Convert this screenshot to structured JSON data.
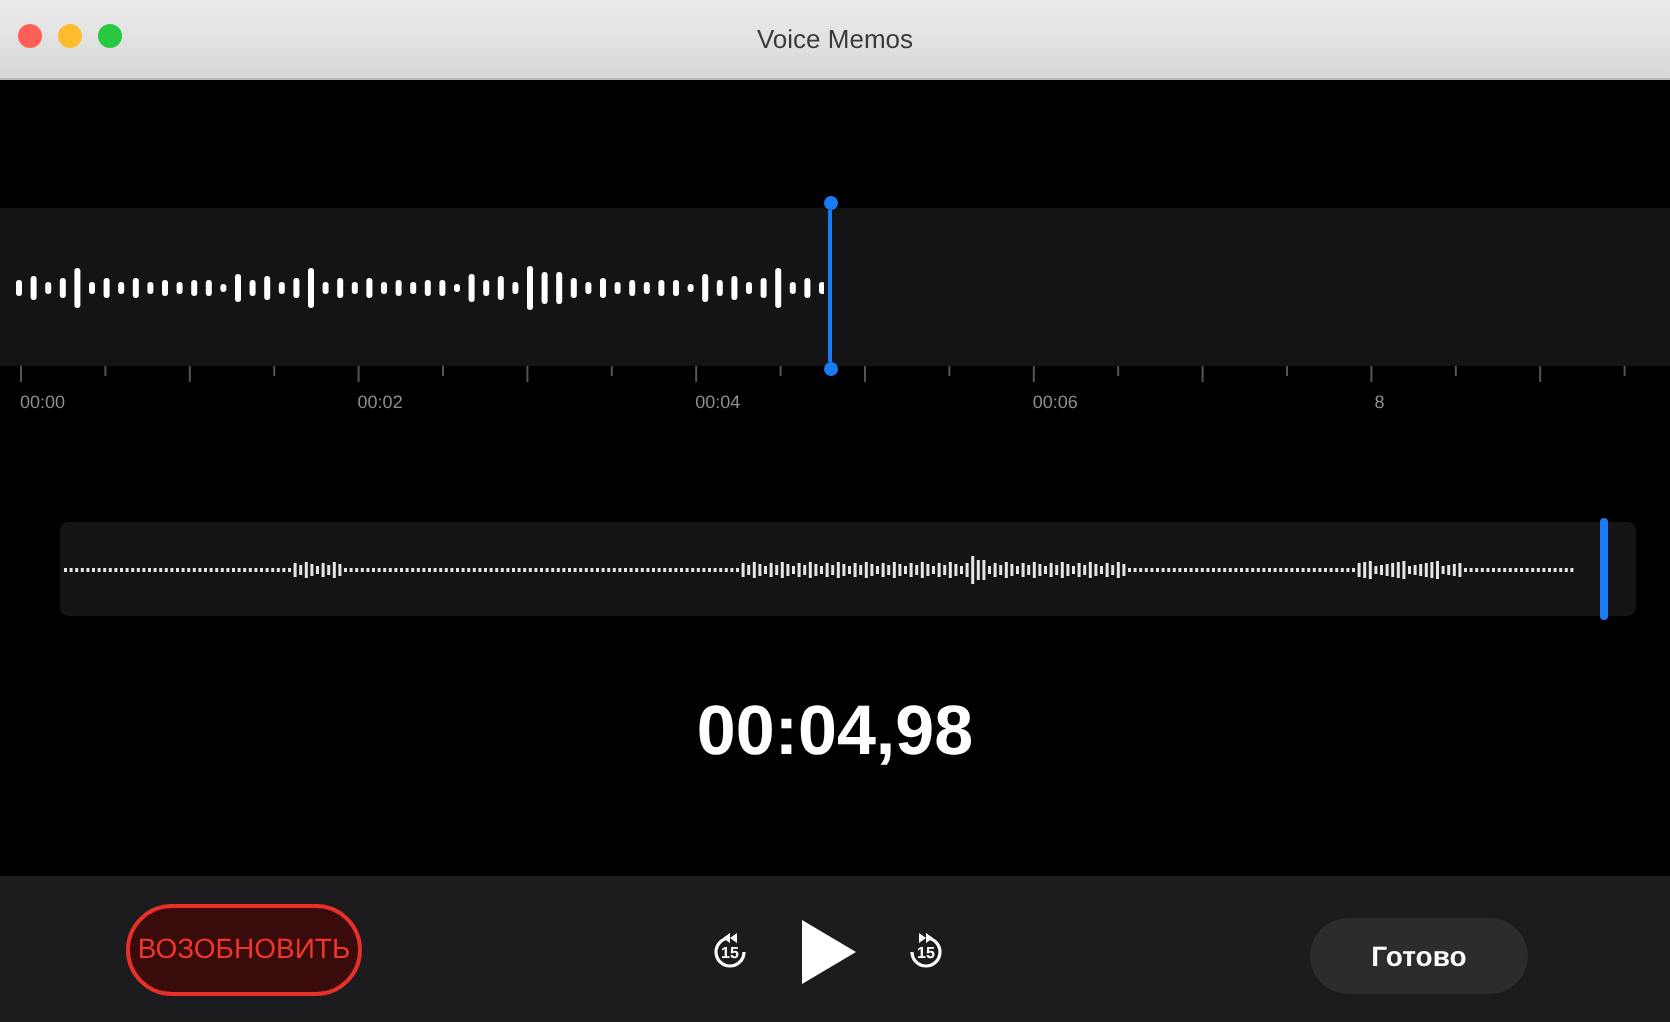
{
  "window": {
    "title": "Voice Memos"
  },
  "timeline": {
    "ticks": [
      {
        "label": "00:00"
      },
      {
        "label": "00:02"
      },
      {
        "label": "00:04"
      },
      {
        "label": "00:06"
      },
      {
        "label": "8"
      }
    ]
  },
  "time_display": "00:04,98",
  "controls": {
    "resume_button": "ВОЗОБНОВИТЬ",
    "skip_back": "15",
    "skip_forward": "15",
    "done_button": "Готово"
  }
}
